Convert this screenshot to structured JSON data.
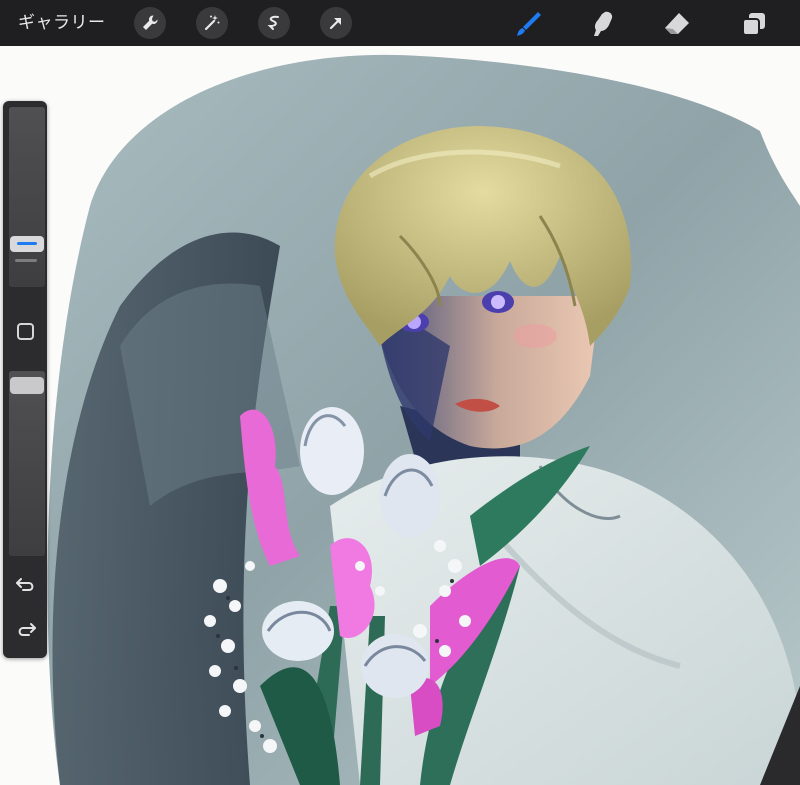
{
  "topbar": {
    "gallery_label": "ギャラリー",
    "left_tools": [
      "wrench-icon",
      "magic-wand-icon",
      "selection-icon",
      "transform-arrow-icon"
    ],
    "right_tools": [
      "brush-icon",
      "smudge-icon",
      "eraser-icon",
      "layers-icon"
    ],
    "active_tool": "brush-icon",
    "accent_color": "#1f7bf2"
  },
  "sidebar": {
    "brush_size": 0.62,
    "opacity": 1.0,
    "buttons": [
      "modify-square-icon",
      "undo-icon",
      "redo-icon"
    ]
  },
  "canvas": {
    "artwork": "painting"
  }
}
